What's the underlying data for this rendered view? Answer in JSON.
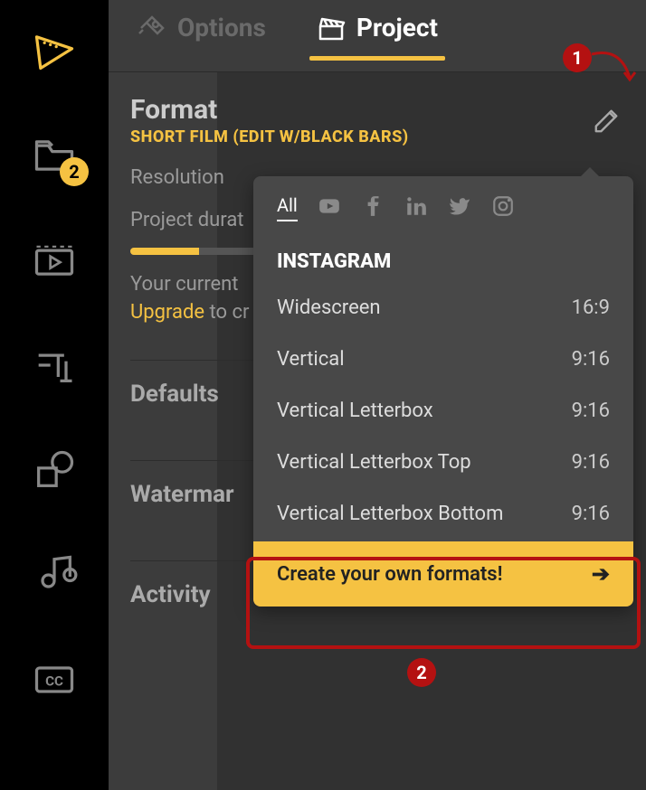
{
  "sidebar": {
    "badge": "2"
  },
  "tabs": {
    "options": "Options",
    "project": "Project"
  },
  "format": {
    "title": "Format",
    "subtitle": "SHORT FILM (EDIT W/BLACK BARS)",
    "resolution_label": "Resolution",
    "duration_label": "Project durat",
    "info_prefix": "Your current ",
    "info_link": "Upgrade",
    "info_suffix": " to cr"
  },
  "sections": {
    "defaults": "Defaults",
    "watermark": "Watermar",
    "activity": "Activity"
  },
  "popover": {
    "all": "All",
    "section": "INSTAGRAM",
    "items": [
      {
        "name": "Widescreen",
        "ratio": "16:9"
      },
      {
        "name": "Vertical",
        "ratio": "9:16"
      },
      {
        "name": "Vertical Letterbox",
        "ratio": "9:16"
      },
      {
        "name": "Vertical Letterbox Top",
        "ratio": "9:16"
      },
      {
        "name": "Vertical Letterbox Bottom",
        "ratio": "9:16"
      }
    ],
    "create": "Create your own formats!"
  },
  "callouts": {
    "one": "1",
    "two": "2"
  }
}
